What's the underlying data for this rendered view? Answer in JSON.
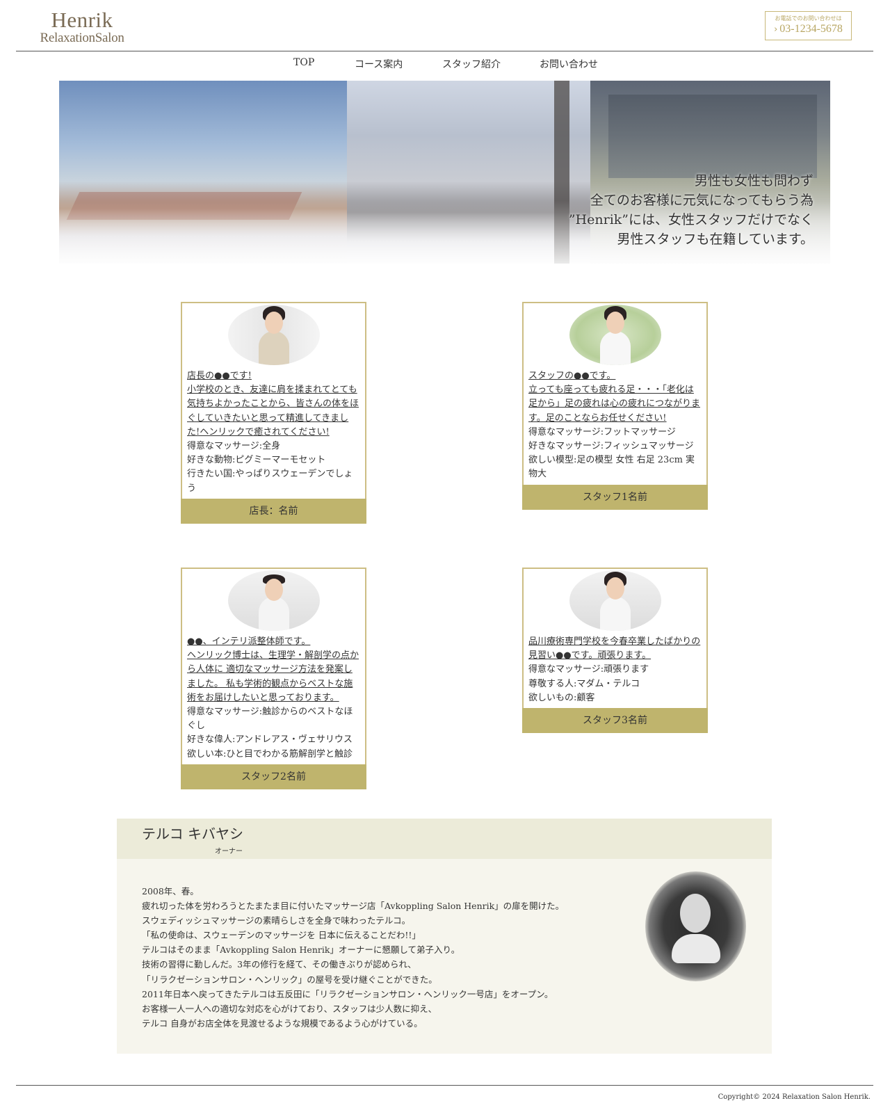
{
  "header": {
    "logo_main": "Henrik",
    "logo_sub": "RelaxationSalon",
    "phone_caption": "お電話でのお問い合わせは",
    "phone_icon": "chevron-right-icon",
    "phone_number": "03-1234-5678"
  },
  "nav": {
    "items": [
      {
        "label": "TOP"
      },
      {
        "label": "コース案内"
      },
      {
        "label": "スタッフ紹介"
      },
      {
        "label": "お問い合わせ"
      }
    ]
  },
  "hero": {
    "lines": [
      "男性も女性も問わず",
      "全てのお客様に元気になってもらう為",
      "”Henrik”には、女性スタッフだけでなく",
      "男性スタッフも在籍しています。"
    ]
  },
  "staff": [
    {
      "intro": "店長の●●です!\n小学校のとき、友達に肩を揉まれてとても気持ちよかったことから、皆さんの体をほぐしていきたいと思って精進してきました!ヘンリックで癒されてください!",
      "specs": [
        "得意なマッサージ:全身",
        "好きな動物:ピグミーマーモセット",
        "行きたい国:やっぱりスウェーデンでしょう"
      ],
      "name": "店長：名前"
    },
    {
      "intro": "スタッフの●●です。\n立っても座っても疲れる足・・・「老化は足から」足の疲れは心の疲れにつながります。足のことならお任せください!",
      "specs": [
        "得意なマッサージ:フットマッサージ",
        "好きなマッサージ:フィッシュマッサージ",
        "欲しい模型:足の模型 女性 右足 23cm 実物大"
      ],
      "name": "スタッフ1名前"
    },
    {
      "intro": "●●、インテリ派整体師です。\nヘンリック博士は、生理学・解剖学の点から人体に 適切なマッサージ方法を発案しました。 私も学術的観点からベストな施術をお届けしたいと思っております。",
      "specs": [
        "得意なマッサージ:触診からのベストなほぐし",
        "好きな偉人:アンドレアス・ヴェサリウス",
        "欲しい本:ひと目でわかる筋解剖学と触診"
      ],
      "name": "スタッフ2名前"
    },
    {
      "intro": "品川療術専門学校を今春卒業したばかりの見習い●●です。頑張ります。",
      "specs": [
        "得意なマッサージ:頑張ります",
        "尊敬する人:マダム・テルコ",
        "欲しいもの:顧客"
      ],
      "name": "スタッフ3名前"
    }
  ],
  "owner": {
    "name": "テルコ キバヤシ",
    "role": "オーナー",
    "bio": [
      "2008年、春。",
      "疲れ切った体を労わろうとたまたま目に付いたマッサージ店「Avkoppling Salon Henrik」の扉を開けた。",
      "スウェディッシュマッサージの素晴らしさを全身で味わったテルコ。",
      "「私の使命は、スウェーデンのマッサージを 日本に伝えることだわ!!」",
      "テルコはそのまま「Avkoppling Salon Henrik」オーナーに懇願して弟子入り。",
      "技術の習得に勤しんだ。3年の修行を経て、その働きぶりが認められ、",
      "「リラクゼーションサロン・ヘンリック」の屋号を受け継ぐことができた。",
      "2011年日本へ戻ってきたテルコは五反田に「リラクゼーションサロン・ヘンリック一号店」をオープン。",
      "お客様一人一人への適切な対応を心がけており、スタッフは少人数に抑え、",
      "テルコ 自身がお店全体を見渡せるような規模であるよう心がけている。"
    ]
  },
  "footer": {
    "copyright": "Copyright© 2024 Relaxation Salon Henrik."
  },
  "colors": {
    "accent": "#bfb46d",
    "card_border": "#cdbe84",
    "logo": "#7a6b55",
    "phone": "#b8a662",
    "owner_bg": "#f6f5ed",
    "owner_head_bg": "#ecebd9"
  }
}
